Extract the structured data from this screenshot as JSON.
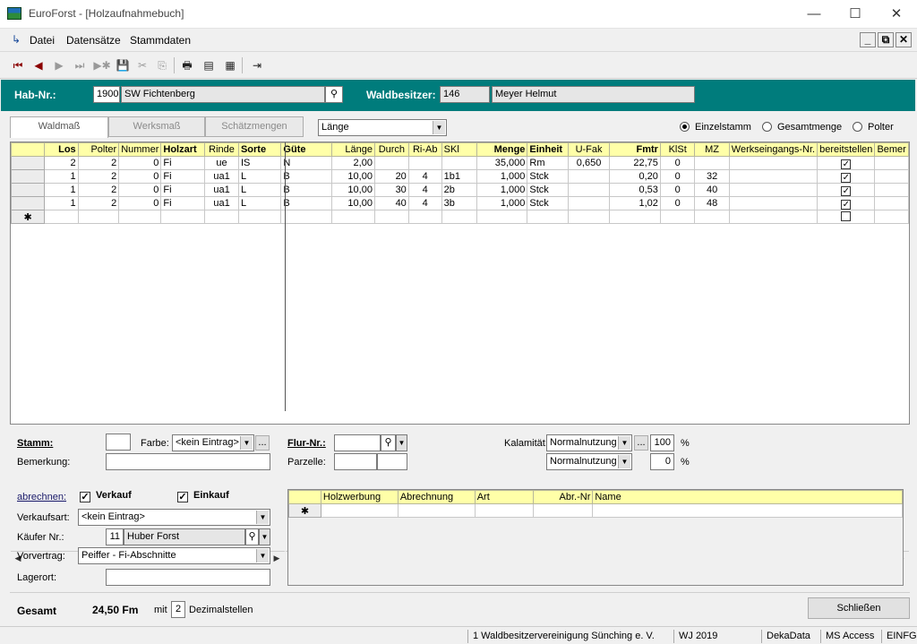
{
  "window": {
    "title": "EuroForst - [Holzaufnahmebuch]",
    "minimize": "—",
    "maximize": "☐",
    "close": "✕"
  },
  "menu": {
    "items": [
      "Datei",
      "Datensätze",
      "Stammdaten"
    ],
    "mdi_min": "_",
    "mdi_restore": "⧉",
    "mdi_close": "✕"
  },
  "header": {
    "hab_label": "Hab-Nr.:",
    "hab_nr": "1900",
    "hab_name": "SW Fichtenberg",
    "waldbesitzer_label": "Waldbesitzer:",
    "waldbesitzer_nr": "146",
    "waldbesitzer_name": "Meyer Helmut"
  },
  "tabs": {
    "waldmass": "Waldmaß",
    "werksmass": "Werksmaß",
    "schaetzmengen": "Schätzmengen"
  },
  "measure_select": {
    "value": "Länge"
  },
  "mode_radios": {
    "einzelstamm": "Einzelstamm",
    "gesamtmenge": "Gesamtmenge",
    "polter": "Polter",
    "selected": "einzelstamm"
  },
  "grid": {
    "columns": [
      "Los",
      "Polter",
      "Nummer",
      "Holzart",
      "Rinde",
      "Sorte",
      "Güte",
      "Länge",
      "Durch",
      "Ri-Ab",
      "SKl",
      "Menge",
      "Einheit",
      "U-Fak",
      "Fmtr",
      "KlSt",
      "MZ",
      "Werkseingangs-Nr.",
      "bereitstellen",
      "Bemer"
    ],
    "rows": [
      [
        "2",
        "2",
        "0",
        "Fi",
        "ue",
        "IS",
        "N",
        "2,00",
        "",
        "",
        "",
        "35,000",
        "Rm",
        "0,650",
        "22,75",
        "0",
        "",
        "",
        true,
        ""
      ],
      [
        "1",
        "2",
        "0",
        "Fi",
        "ua1",
        "L",
        "B",
        "10,00",
        "20",
        "4",
        "1b1",
        "1,000",
        "Stck",
        "",
        "0,20",
        "0",
        "32",
        "",
        true,
        ""
      ],
      [
        "1",
        "2",
        "0",
        "Fi",
        "ua1",
        "L",
        "B",
        "10,00",
        "30",
        "4",
        "2b",
        "1,000",
        "Stck",
        "",
        "0,53",
        "0",
        "40",
        "",
        true,
        ""
      ],
      [
        "1",
        "2",
        "0",
        "Fi",
        "ua1",
        "L",
        "B",
        "10,00",
        "40",
        "4",
        "3b",
        "1,000",
        "Stck",
        "",
        "1,02",
        "0",
        "48",
        "",
        true,
        ""
      ]
    ],
    "new_row_marker": "✱"
  },
  "stamm": {
    "stamm_label": "Stamm:",
    "stamm_value": "",
    "farbe_label": "Farbe:",
    "farbe_value": "<kein Eintrag>",
    "ellipsis": "...",
    "bemerkung_label": "Bemerkung:",
    "bemerkung_value": "",
    "flur_label": "Flur-Nr.:",
    "flur_value": "",
    "parzelle_label": "Parzelle:",
    "kalamitaet_label": "Kalamität:",
    "kalamitaet_value": "Normalnutzung",
    "kalamitaet_pct": "100",
    "pct_sign": "%",
    "nutzung2_value": "Normalnutzung",
    "nutzung2_pct": "0"
  },
  "abrechnen": {
    "label": "abrechnen:",
    "verkauf": "Verkauf",
    "einkauf": "Einkauf",
    "verkaufsart_label": "Verkaufsart:",
    "verkaufsart_value": "<kein Eintrag>",
    "kaeufer_label": "Käufer Nr.:",
    "kaeufer_nr": "11",
    "kaeufer_name": "Huber Forst",
    "vorvertrag_label": "Vorvertrag:",
    "vorvertrag_value": "Peiffer - Fi-Abschnitte",
    "lagerort_label": "Lagerort:",
    "lagerort_value": ""
  },
  "subgrid": {
    "columns": [
      "Holzwerbung",
      "Abrechnung",
      "Art",
      "Abr.-Nr",
      "Name"
    ],
    "new_row_marker": "✱"
  },
  "footer": {
    "gesamt_label": "Gesamt",
    "gesamt_value": "24,50 Fm",
    "mit_label": "mit",
    "decimals": "2",
    "dezimal_label": "Dezimalstellen",
    "close_button": "Schließen"
  },
  "status": {
    "org": "1 Waldbesitzervereinigung Sünching e. V.",
    "wj": "WJ 2019",
    "vendor": "DekaData",
    "db": "MS Access",
    "mode": "EINFG"
  },
  "colors": {
    "header_bg": "#007c7c",
    "grid_header": "#ffffa8",
    "nav_red": "#8b0000"
  }
}
